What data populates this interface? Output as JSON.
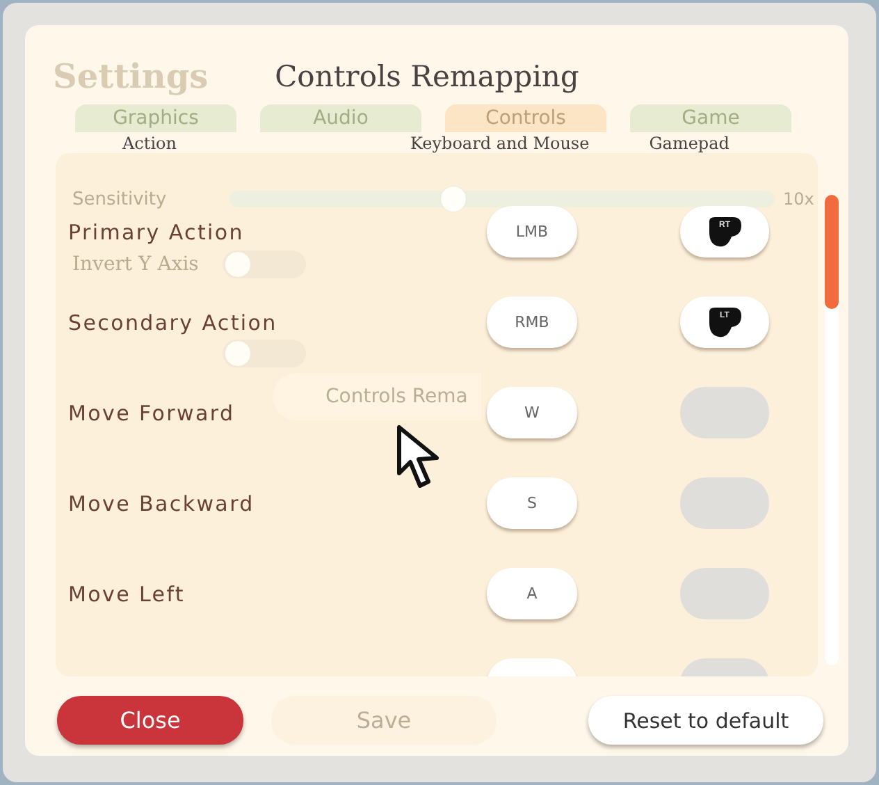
{
  "background_settings": {
    "title": "Settings",
    "tabs": [
      {
        "label": "Graphics",
        "selected": false
      },
      {
        "label": "Audio",
        "selected": false
      },
      {
        "label": "Controls",
        "selected": true
      },
      {
        "label": "Game",
        "selected": false
      }
    ],
    "sensitivity": {
      "label": "Sensitivity",
      "level": 0.41,
      "reading": "10x"
    },
    "invert_y_axis": {
      "label": "Invert Y Axis",
      "on": false
    },
    "toggle_2": {
      "on": false
    },
    "remap_button": "Controls Rema",
    "save_button": "Save"
  },
  "dialog": {
    "title": "Controls Remapping",
    "columns": [
      "Action",
      "Keyboard and Mouse",
      "Gamepad"
    ],
    "rows": [
      {
        "kind": "full",
        "action": "Primary Action",
        "keyboard": "LMB",
        "gamepad": "RT",
        "gamepad_bound": true
      },
      {
        "kind": "full",
        "action": "Secondary Action",
        "keyboard": "RMB",
        "gamepad": "LT",
        "gamepad_bound": true
      },
      {
        "kind": "full",
        "action": "Move Forward",
        "keyboard": "W",
        "gamepad_bound": false
      },
      {
        "kind": "full",
        "action": "Move Backward",
        "keyboard": "S",
        "gamepad_bound": false
      },
      {
        "kind": "full",
        "action": "Move Left",
        "keyboard": "A",
        "gamepad_bound": false
      },
      {
        "kind": "cut",
        "gamepad_bound": false
      }
    ],
    "buttons": {
      "close": "Close",
      "reset": "Reset to default"
    }
  }
}
